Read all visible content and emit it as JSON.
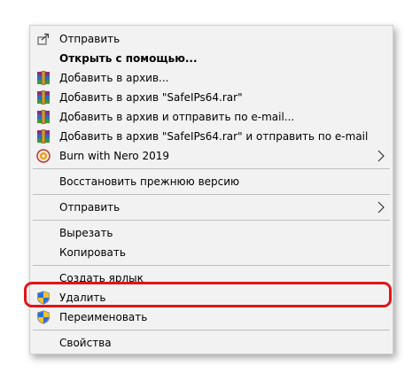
{
  "context_menu": {
    "items": [
      {
        "label": "Отправить",
        "icon": "share-icon",
        "bold": false,
        "submenu": false
      },
      {
        "label": "Открыть с помощью...",
        "icon": null,
        "bold": true,
        "submenu": false
      },
      {
        "label": "Добавить в архив...",
        "icon": "winrar-icon",
        "bold": false,
        "submenu": false
      },
      {
        "label": "Добавить в архив \"SafeIPs64.rar\"",
        "icon": "winrar-icon",
        "bold": false,
        "submenu": false
      },
      {
        "label": "Добавить в архив и отправить по e-mail...",
        "icon": "winrar-icon",
        "bold": false,
        "submenu": false
      },
      {
        "label": "Добавить в архив \"SafeIPs64.rar\" и отправить по e-mail",
        "icon": "winrar-icon",
        "bold": false,
        "submenu": false
      },
      {
        "label": "Burn with Nero 2019",
        "icon": "nero-icon",
        "bold": false,
        "submenu": true
      },
      {
        "label": "Восстановить прежнюю версию",
        "icon": null,
        "bold": false,
        "submenu": false
      },
      {
        "label": "Отправить",
        "icon": null,
        "bold": false,
        "submenu": true
      },
      {
        "label": "Вырезать",
        "icon": null,
        "bold": false,
        "submenu": false
      },
      {
        "label": "Копировать",
        "icon": null,
        "bold": false,
        "submenu": false
      },
      {
        "label": "Создать ярлык",
        "icon": null,
        "bold": false,
        "submenu": false
      },
      {
        "label": "Удалить",
        "icon": "uac-shield-icon",
        "bold": false,
        "submenu": false,
        "highlighted": true
      },
      {
        "label": "Переименовать",
        "icon": "uac-shield-icon",
        "bold": false,
        "submenu": false
      },
      {
        "label": "Свойства",
        "icon": null,
        "bold": false,
        "submenu": false
      }
    ]
  },
  "colors": {
    "menu_background": "#f2f2f2",
    "separator": "#bdbdbd",
    "highlight_border": "#e01616"
  }
}
